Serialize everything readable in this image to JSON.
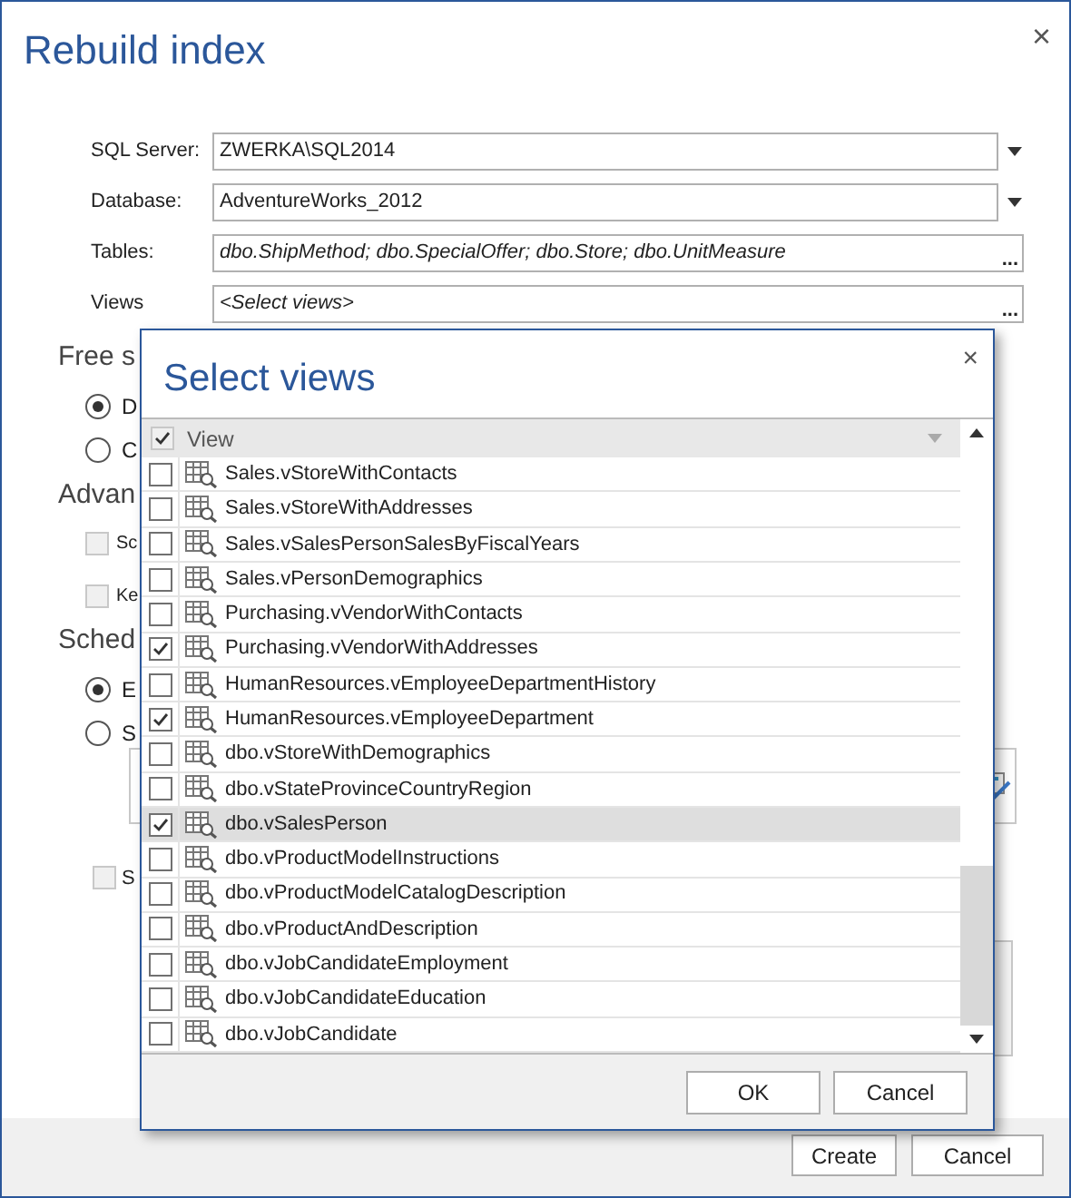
{
  "window": {
    "title": "Rebuild index",
    "close": "×"
  },
  "form": {
    "fields": [
      {
        "label": "SQL Server:",
        "value": "ZWERKA\\SQL2014",
        "kind": "dropdown"
      },
      {
        "label": "Database:",
        "value": "AdventureWorks_2012",
        "kind": "dropdown"
      },
      {
        "label": "Tables:",
        "value": "dbo.ShipMethod; dbo.SpecialOffer; dbo.Store; dbo.UnitMeasure",
        "kind": "browse",
        "button": "..."
      },
      {
        "label": "Views",
        "value": "<Select views>",
        "kind": "browse",
        "button": "..."
      }
    ]
  },
  "background_sections": [
    {
      "heading": "Free s",
      "items": [
        {
          "kind": "radio",
          "label": "D",
          "selected": true
        },
        {
          "kind": "radio",
          "label": "C",
          "selected": false
        }
      ]
    },
    {
      "heading": "Advan",
      "items": [
        {
          "kind": "checkbox",
          "label": "Sc",
          "checked": false
        },
        {
          "kind": "checkbox",
          "label": "Ke",
          "checked": false
        }
      ]
    },
    {
      "heading": "Sched",
      "items": [
        {
          "kind": "radio",
          "label": "E",
          "selected": true
        },
        {
          "kind": "radio",
          "label": "S",
          "selected": false
        }
      ]
    }
  ],
  "schedule_checkbox": {
    "label": "S",
    "checked": false
  },
  "footer": {
    "buttons": [
      "Create",
      "Cancel"
    ]
  },
  "dialog": {
    "title": "Select views",
    "close": "×",
    "header": {
      "label": "View",
      "checked": true
    },
    "rows": [
      {
        "name": "Sales.vStoreWithContacts",
        "checked": false,
        "selected": false
      },
      {
        "name": "Sales.vStoreWithAddresses",
        "checked": false,
        "selected": false
      },
      {
        "name": "Sales.vSalesPersonSalesByFiscalYears",
        "checked": false,
        "selected": false
      },
      {
        "name": "Sales.vPersonDemographics",
        "checked": false,
        "selected": false
      },
      {
        "name": "Purchasing.vVendorWithContacts",
        "checked": false,
        "selected": false
      },
      {
        "name": "Purchasing.vVendorWithAddresses",
        "checked": true,
        "selected": false
      },
      {
        "name": "HumanResources.vEmployeeDepartmentHistory",
        "checked": false,
        "selected": false
      },
      {
        "name": "HumanResources.vEmployeeDepartment",
        "checked": true,
        "selected": false
      },
      {
        "name": "dbo.vStoreWithDemographics",
        "checked": false,
        "selected": false
      },
      {
        "name": "dbo.vStateProvinceCountryRegion",
        "checked": false,
        "selected": false
      },
      {
        "name": "dbo.vSalesPerson",
        "checked": true,
        "selected": true
      },
      {
        "name": "dbo.vProductModelInstructions",
        "checked": false,
        "selected": false
      },
      {
        "name": "dbo.vProductModelCatalogDescription",
        "checked": false,
        "selected": false
      },
      {
        "name": "dbo.vProductAndDescription",
        "checked": false,
        "selected": false
      },
      {
        "name": "dbo.vJobCandidateEmployment",
        "checked": false,
        "selected": false
      },
      {
        "name": "dbo.vJobCandidateEducation",
        "checked": false,
        "selected": false
      },
      {
        "name": "dbo.vJobCandidate",
        "checked": false,
        "selected": false
      }
    ],
    "buttons": [
      "OK",
      "Cancel"
    ]
  }
}
